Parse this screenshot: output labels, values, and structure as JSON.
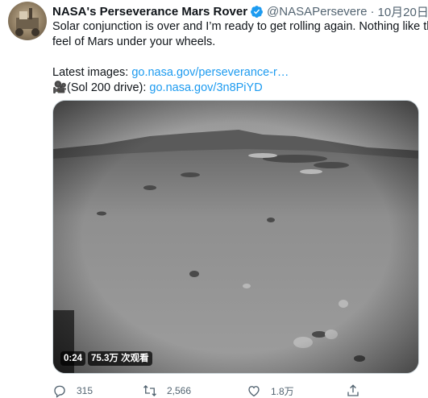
{
  "tweet": {
    "name": "NASA's Perseverance Mars Rover",
    "handle": "@NASAPersevere",
    "separator": "·",
    "time": "10月20日",
    "text_line1": "Solar conjunction is over and I’m ready to get rolling again. Nothing like the",
    "text_line2": "feel of Mars under your wheels.",
    "latest_prefix": "Latest images: ",
    "latest_link": "go.nasa.gov/perseverance-r…",
    "sol_prefix": "🎥(Sol 200 drive): ",
    "sol_link": "go.nasa.gov/3n8PiYD"
  },
  "video": {
    "duration": "0:24",
    "views": "75.3万 次观看"
  },
  "actions": {
    "reply_count": "315",
    "retweet_count": "2,566",
    "like_count": "1.8万"
  },
  "colors": {
    "link": "#1d9bf0",
    "verified": "#1d9bf0",
    "secondary_text": "#536471"
  },
  "icons": [
    "verified-badge-icon",
    "reply-icon",
    "retweet-icon",
    "like-icon",
    "share-icon"
  ]
}
